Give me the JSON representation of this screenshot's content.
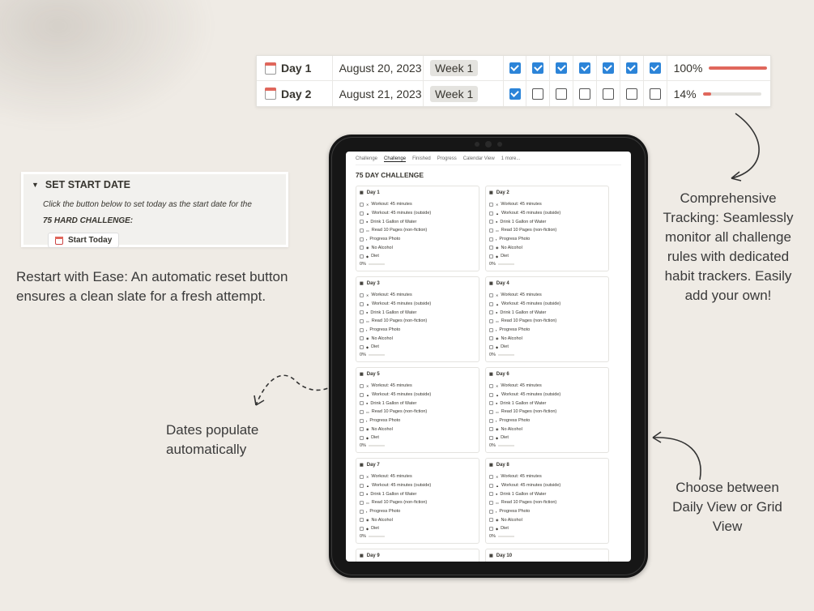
{
  "tracker": {
    "rows": [
      {
        "day": "Day 1",
        "date": "August 20, 2023",
        "week": "Week 1",
        "checks": [
          true,
          true,
          true,
          true,
          true,
          true,
          true
        ],
        "percent_label": "100%",
        "percent": 1.0
      },
      {
        "day": "Day 2",
        "date": "August 21, 2023",
        "week": "Week 1",
        "checks": [
          true,
          false,
          false,
          false,
          false,
          false,
          false
        ],
        "percent_label": "14%",
        "percent": 0.14
      }
    ]
  },
  "start_card": {
    "heading": "SET START DATE",
    "line1": "Click the button below to set today as the start date for the",
    "line2": "75 HARD CHALLENGE:",
    "button": "Start Today"
  },
  "captions": {
    "restart": "Restart with Ease: An automatic reset button ensures a clean slate for a fresh attempt.",
    "dates": "Dates populate automatically",
    "tracking": "Comprehensive Tracking: Seamlessly monitor all challenge rules with dedicated habit trackers. Easily add your own!",
    "view": "Choose between Daily View or Grid View"
  },
  "app": {
    "tabs": [
      "Challenge",
      "Challenge",
      "Finished",
      "Progress",
      "Calendar View",
      "1 more..."
    ],
    "active_tab": 1,
    "title": "75 DAY CHALLENGE",
    "habits": [
      "Workout: 45 minutes",
      "Workout: 45 minutes (outside)",
      "Drink 1 Gallon of Water",
      "Read 10 Pages (non-fiction)",
      "Progress Photo",
      "No Alcohol",
      "Diet"
    ],
    "progress_label": "0%",
    "days": [
      "Day 1",
      "Day 2",
      "Day 3",
      "Day 4",
      "Day 5",
      "Day 6",
      "Day 7",
      "Day 8",
      "Day 9",
      "Day 10"
    ]
  },
  "colors": {
    "accent_blue": "#2c84d8",
    "progress_red": "#e0675c",
    "background": "#efebe5"
  }
}
